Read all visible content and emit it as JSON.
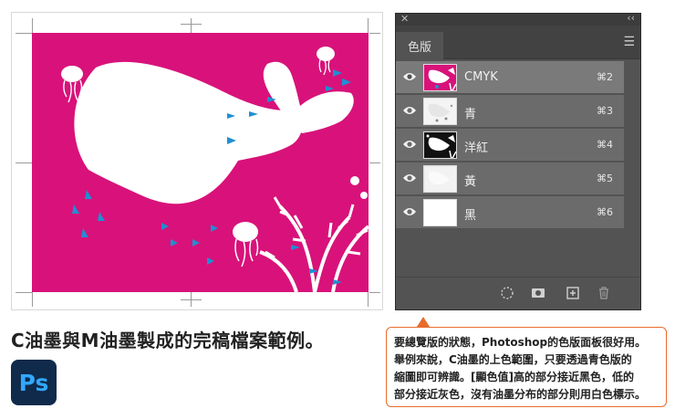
{
  "caption": "C油墨與M油墨製成的完稿檔案範例。",
  "ps_logo": {
    "text": "Ps"
  },
  "panel": {
    "tab_label": "色版",
    "channels": [
      {
        "name": "CMYK",
        "shortcut": "⌘2",
        "thumb": "composite"
      },
      {
        "name": "青",
        "shortcut": "⌘3",
        "thumb": "cyan"
      },
      {
        "name": "洋紅",
        "shortcut": "⌘4",
        "thumb": "magenta"
      },
      {
        "name": "黃",
        "shortcut": "⌘5",
        "thumb": "yellow"
      },
      {
        "name": "黑",
        "shortcut": "⌘6",
        "thumb": "black"
      }
    ]
  },
  "note": {
    "lines": [
      "要總覽版的狀態，Photoshop的色版面板很好用。",
      "舉例來說，C油墨的上色範圍，只要透過青色版的",
      "縮圖即可辨識。[顯色值]高的部分接近黑色，低的",
      "部分接近灰色，沒有油墨分布的部分則用白色標示。"
    ]
  },
  "colors": {
    "artwork_background": "#d8127a",
    "accent_blue": "#1f8fd3",
    "note_border": "#e86b2c",
    "panel_background": "#535353"
  }
}
